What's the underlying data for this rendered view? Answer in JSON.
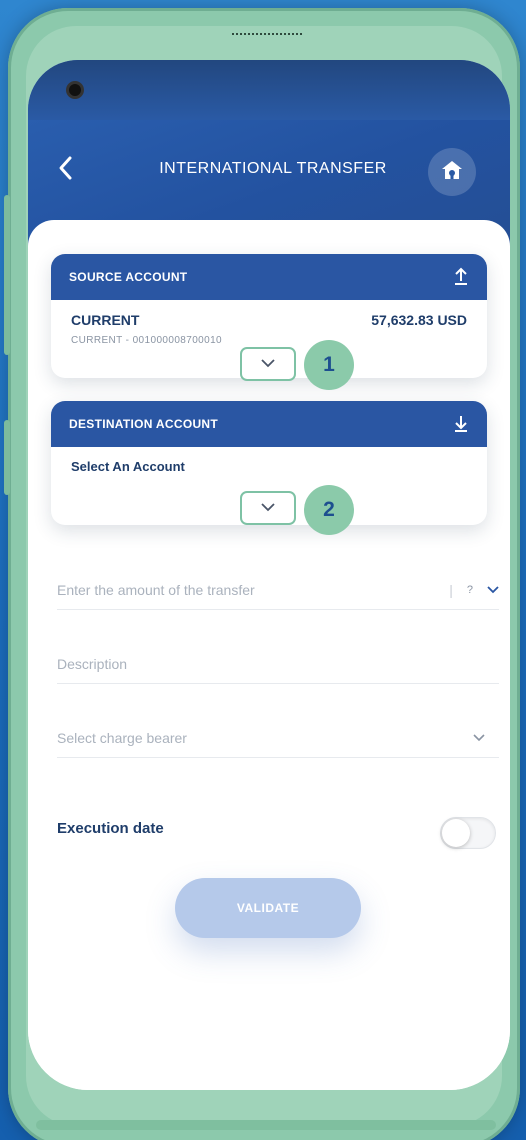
{
  "header": {
    "title": "INTERNATIONAL TRANSFER",
    "back_icon": "chevron-left-icon",
    "home_icon": "home-icon"
  },
  "source": {
    "heading": "SOURCE ACCOUNT",
    "icon": "upload-icon",
    "account_name": "CURRENT",
    "account_number": "CURRENT - 001000008700010",
    "balance": "57,632.83 USD"
  },
  "destination": {
    "heading": "DESTINATION ACCOUNT",
    "icon": "download-icon",
    "placeholder": "Select An Account"
  },
  "badges": {
    "one": "1",
    "two": "2"
  },
  "form": {
    "amount_placeholder": "Enter the amount of the transfer",
    "amount_separator": "|",
    "currency_help": "?",
    "description_placeholder": "Description",
    "charge_placeholder": "Select charge bearer"
  },
  "execution": {
    "label": "Execution date",
    "enabled": false
  },
  "actions": {
    "validate_label": "VALIDATE"
  },
  "colors": {
    "primary": "#2a56a3",
    "text_dark": "#1f3d6a",
    "accent_green": "#8bcaaa",
    "button_disabled": "#b5c9ea"
  }
}
